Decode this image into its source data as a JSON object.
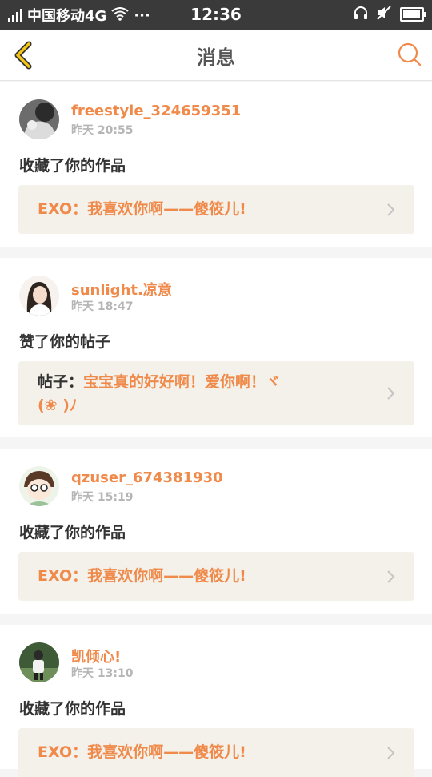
{
  "status_bar": {
    "carrier": "中国移动4G",
    "time": "12:36",
    "more": "···"
  },
  "header": {
    "title": "消息"
  },
  "colors": {
    "accent": "#f08a4b",
    "back_arrow": "#f5c518"
  },
  "messages": [
    {
      "user": "freestyle_324659351",
      "time": "昨天 20:55",
      "action": "收藏了你的作品",
      "quote": "EXO：我喜欢你啊——傻筱儿!"
    },
    {
      "user": "sunlight.凉意",
      "time": "昨天 18:47",
      "action": "赞了你的帖子",
      "quote_label": "帖子：",
      "quote": "宝宝真的好好啊！爱你啊！ヾ",
      "quote_line2": "(❀          )ﾉ"
    },
    {
      "user": "qzuser_674381930",
      "time": "昨天 15:19",
      "action": "收藏了你的作品",
      "quote": "EXO：我喜欢你啊——傻筱儿!"
    },
    {
      "user": "凯倾心!",
      "time": "昨天 13:10",
      "action": "收藏了你的作品",
      "quote": "EXO：我喜欢你啊——傻筱儿!"
    }
  ]
}
